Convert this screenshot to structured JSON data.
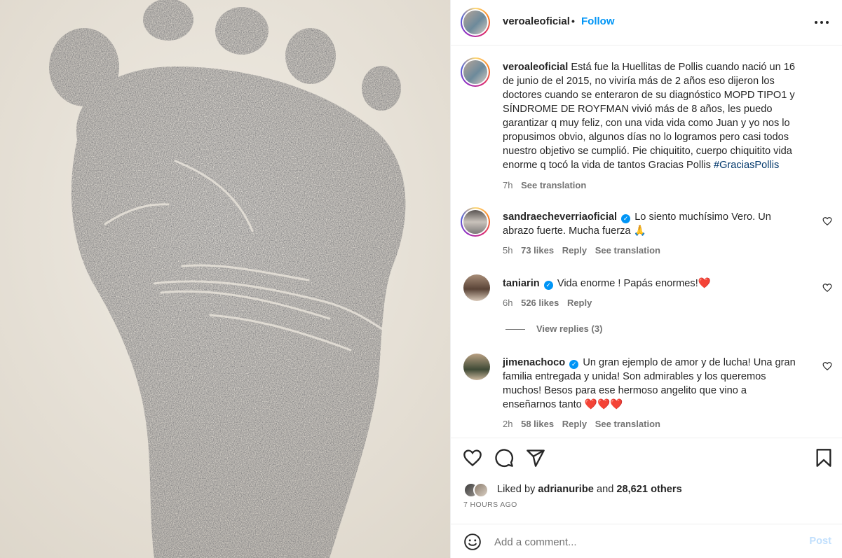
{
  "post": {
    "username": "veroaleoficial",
    "separator": "•",
    "follow_label": "Follow",
    "more_icon": "more-horizontal-icon"
  },
  "caption": {
    "username": "veroaleoficial",
    "text": "Está fue la Huellitas de Pollis cuando nació un 16 de junio de el 2015, no viviría más de 2 años eso dijeron los doctores cuando se enteraron de su diagnóstico MOPD TIPO1 y SÍNDROME DE ROYFMAN vivió más de 8 años, les puedo garantizar q muy feliz, con una vida vida como Juan y yo nos lo propusimos obvio, algunos días no lo logramos pero casi todos nuestro objetivo se cumplió. Pie chiquitito, cuerpo chiquitito vida enorme q tocó la vida de tantos Gracias Pollis",
    "hashtag": "#GraciasPollis",
    "time": "7h",
    "see_translation": "See translation"
  },
  "comments": [
    {
      "username": "sandraecheverriaoficial",
      "text": "Lo siento muchísimo Vero. Un abrazo fuerte. Mucha fuerza",
      "emoji": "🙏",
      "time": "5h",
      "likes": "73 likes",
      "reply": "Reply",
      "see_translation": "See translation"
    },
    {
      "username": "taniarin",
      "text": "Vida enorme ! Papás enormes!",
      "emoji": "❤️",
      "time": "6h",
      "likes": "526 likes",
      "reply": "Reply"
    },
    {
      "username": "jimenachoco",
      "text": "Un gran ejemplo de amor y de lucha! Una gran familia entregada y unida! Son admirables y los queremos muchos! Besos para ese hermoso angelito que vino a enseñarnos tanto",
      "emoji": "❤️❤️❤️",
      "time": "2h",
      "likes": "58 likes",
      "reply": "Reply",
      "see_translation": "See translation"
    }
  ],
  "view_replies": "View replies (3)",
  "likes": {
    "prefix": "Liked by",
    "user": "adrianuribe",
    "middle": "and",
    "count": "28,621 others"
  },
  "time_ago": "7 HOURS AGO",
  "add_comment": {
    "placeholder": "Add a comment...",
    "post_label": "Post"
  },
  "colors": {
    "accent": "#0095f6",
    "hashtag": "#00376b",
    "muted": "#737373",
    "heart": "#e0242e",
    "post_disabled": "#c0dffd"
  },
  "icons": [
    "heart-icon",
    "comment-icon",
    "share-icon",
    "bookmark-icon",
    "emoji-icon",
    "verified-icon"
  ]
}
